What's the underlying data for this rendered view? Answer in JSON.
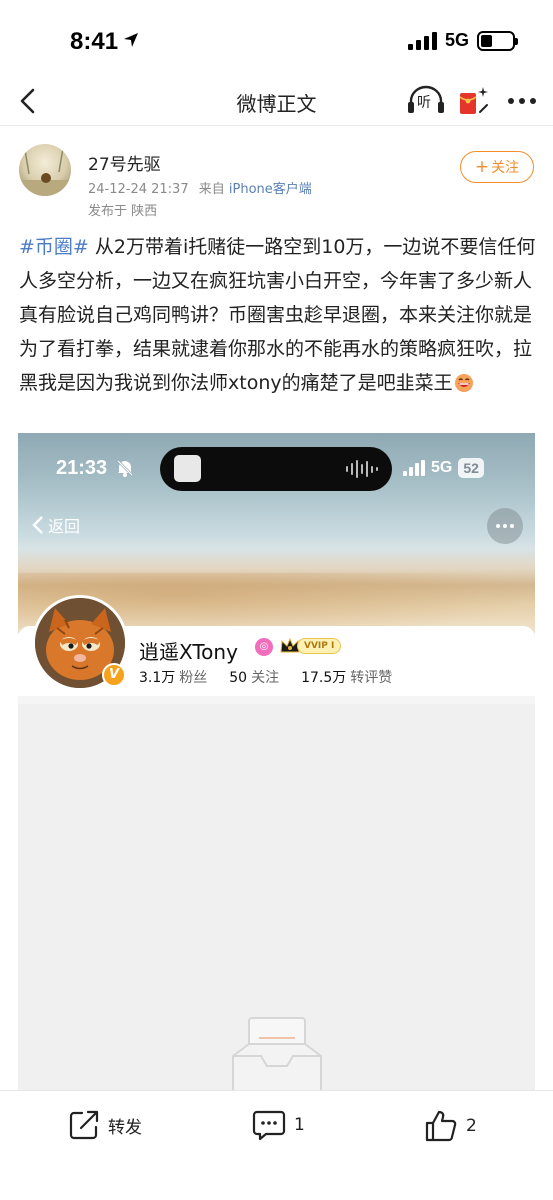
{
  "status_bar": {
    "time": "8:41",
    "network": "5G",
    "battery_level": 0.35
  },
  "nav": {
    "title": "微博正文",
    "listen_label": "听",
    "back_icon": "chevron-left-icon",
    "more_icon": "more-dots-icon"
  },
  "author": {
    "name": "27号先驱",
    "date": "24-12-24 21:37",
    "source_prefix": "来自",
    "source": "iPhone客户端",
    "location": "发布于 陕西",
    "follow_label": "关注"
  },
  "post": {
    "hashtag": "#币圈#",
    "body": " 从2万带着i托赌徒一路空到10万，一边说不要信任何人多空分析，一边又在疯狂坑害小白开空，今年害了多少新人真有脸说自己鸡同鸭讲？币圈害虫趁早退圈，本来关注你就是为了看打拳，结果就逮着你那水的不能再水的策略疯狂吹，拉黑我是因为我说到你法师xtony的痛楚了是吧韭菜王"
  },
  "embedded": {
    "time": "21:33",
    "network": "5G",
    "battery": "52",
    "back_label": "返回",
    "profile_name": "逍遥XTony",
    "vip_tag": "VVIP I",
    "v_badge": "V",
    "stats": [
      {
        "value": "3.1万",
        "label": "粉丝"
      },
      {
        "value": "50",
        "label": "关注"
      },
      {
        "value": "17.5万",
        "label": "转评赞"
      }
    ]
  },
  "toolbar": {
    "repost_label": "转发",
    "comment_count": "1",
    "like_count": "2"
  },
  "colors": {
    "accent": "#f58c2b",
    "link": "#4c7cc4",
    "meta": "#8a8a8a"
  }
}
